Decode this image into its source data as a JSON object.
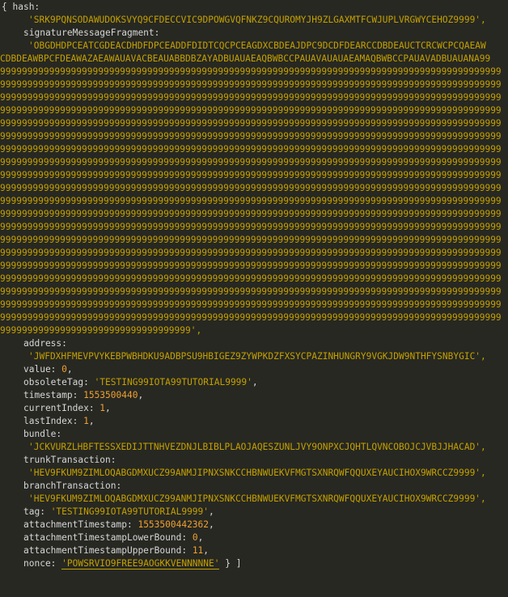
{
  "open_brace": "{ ",
  "hash": {
    "key": "hash:",
    "value": "'SRK9PQNSODAWUDOKSVYQ9CFDECCVIC9DPOWGVQFNKZ9CQUROMYJH9ZLGAXMTFCWJUPLVRGWYCEHOZ9999',"
  },
  "signature": {
    "key": "signatureMessageFragment:",
    "first_line": "'OBGDHDPCEATCGDEACDHDFDPCEADDFDIDTCQCPCEAGDXCBDEAJDPC9DCDFDEARCCDBDEAUCTCRCWCPCQAEAW",
    "second_line": "CDBDEAWBPCFDEAWAZAEAWAUAVACBEAUABBDBZAYADBUAUAEAQBWBCCPAUAVAUAUAEAMAQBWBCCPAUAVADBUAUANA99",
    "nine_line": "99999999999999999999999999999999999999999999999999999999999999999999999999999999999999999999",
    "last_line": "99999999999999999999999999999999999',"
  },
  "fields": [
    {
      "key": "address:",
      "value": "'JWFDXHFMEVPVYKEBPWBHDKU9ADBPSU9HBIGEZ9ZYWPKDZFXSYCPAZINHUNGRY9VGKJDW9NTHFYSNBYGIC',",
      "wrap": true,
      "type": "str"
    },
    {
      "key": "value: ",
      "value": "0",
      "suffix": ",",
      "wrap": false,
      "type": "num"
    },
    {
      "key": "obsoleteTag: ",
      "value": "'TESTING99IOTA99TUTORIAL9999'",
      "suffix": ",",
      "wrap": false,
      "type": "str"
    },
    {
      "key": "timestamp: ",
      "value": "1553500440",
      "suffix": ",",
      "wrap": false,
      "type": "num"
    },
    {
      "key": "currentIndex: ",
      "value": "1",
      "suffix": ",",
      "wrap": false,
      "type": "num"
    },
    {
      "key": "lastIndex: ",
      "value": "1",
      "suffix": ",",
      "wrap": false,
      "type": "num"
    },
    {
      "key": "bundle:",
      "value": "'JCKVURZLHBFTESSXEDIJTTNHVEZDNJLBIBLPLAOJAQESZUNLJVY9ONPXCJQHTLQVNCOBOJCJVBJJHACAD',",
      "wrap": true,
      "type": "str"
    },
    {
      "key": "trunkTransaction:",
      "value": "'HEV9FKUM9ZIMLOQABGDMXUCZ99ANMJIPNXSNKCCHBNWUEKVFMGTSXNRQWFQQUXEYAUCIHOX9WRCCZ9999',",
      "wrap": true,
      "type": "str"
    },
    {
      "key": "branchTransaction:",
      "value": "'HEV9FKUM9ZIMLOQABGDMXUCZ99ANMJIPNXSNKCCHBNWUEKVFMGTSXNRQWFQQUXEYAUCIHOX9WRCCZ9999',",
      "wrap": true,
      "type": "str"
    },
    {
      "key": "tag: ",
      "value": "'TESTING99IOTA99TUTORIAL9999'",
      "suffix": ",",
      "wrap": false,
      "type": "str"
    },
    {
      "key": "attachmentTimestamp: ",
      "value": "1553500442362",
      "suffix": ",",
      "wrap": false,
      "type": "num"
    },
    {
      "key": "attachmentTimestampLowerBound: ",
      "value": "0",
      "suffix": ",",
      "wrap": false,
      "type": "num"
    },
    {
      "key": "attachmentTimestampUpperBound: ",
      "value": "11",
      "suffix": ",",
      "wrap": false,
      "type": "num"
    }
  ],
  "nonce": {
    "key": "nonce: ",
    "value": "'POWSRVIO9FREE9AOGKKVENNNNNE'",
    "close": " } ]"
  }
}
